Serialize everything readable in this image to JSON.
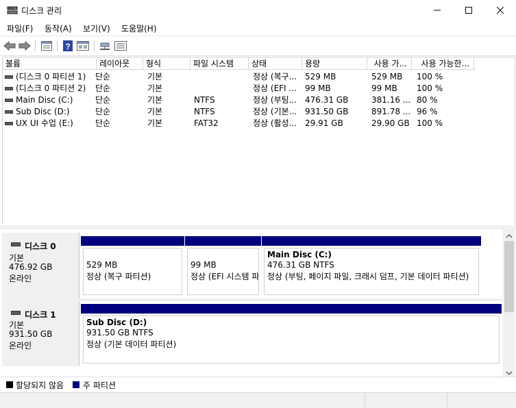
{
  "window": {
    "title": "디스크 관리"
  },
  "menu": [
    "파일(F)",
    "동작(A)",
    "보기(V)",
    "도움말(H)"
  ],
  "toolbar": {
    "buttons": [
      "back-arrow-icon",
      "forward-arrow-icon",
      "properties-icon",
      "help-icon",
      "help-pane-icon",
      "connect-icon",
      "list-icon"
    ]
  },
  "volume_list": {
    "columns": [
      "볼륨",
      "레이아웃",
      "형식",
      "파일 시스템",
      "상태",
      "용량",
      "사용 가...",
      "사용 가능한..."
    ],
    "rows": [
      [
        "(디스크 0 파티션 1)",
        "단순",
        "기본",
        "",
        "정상 (복구...",
        "529 MB",
        "529 MB",
        "100 %"
      ],
      [
        "(디스크 0 파티션 2)",
        "단순",
        "기본",
        "",
        "정상 (EFI ...",
        "99 MB",
        "99 MB",
        "100 %"
      ],
      [
        "Main Disc (C:)",
        "단순",
        "기본",
        "NTFS",
        "정상 (부팅...",
        "476.31 GB",
        "381.16 ...",
        "80 %"
      ],
      [
        "Sub Disc (D:)",
        "단순",
        "기본",
        "NTFS",
        "정상 (기본...",
        "931.50 GB",
        "891.78 ...",
        "96 %"
      ],
      [
        "UX UI 수업 (E:)",
        "단순",
        "기본",
        "FAT32",
        "정상 (활성...",
        "29.91 GB",
        "29.90 GB",
        "100 %"
      ]
    ]
  },
  "disks": [
    {
      "name": "디스크 0",
      "type": "기본",
      "size": "476.92 GB",
      "status": "온라인",
      "partitions": [
        {
          "title": "",
          "size": "529 MB",
          "status": "정상 (복구 파티션)"
        },
        {
          "title": "",
          "size": "99 MB",
          "status": "정상 (EFI 시스템 파"
        },
        {
          "title": "Main Disc  (C:)",
          "size": "476.31 GB NTFS",
          "status": "정상 (부팅, 페이지 파일, 크래시 덤프, 기본 데이터 파티션)"
        }
      ]
    },
    {
      "name": "디스크 1",
      "type": "기본",
      "size": "931.50 GB",
      "status": "온라인",
      "partitions": [
        {
          "title": "Sub Disc  (D:)",
          "size": "931.50 GB NTFS",
          "status": "정상 (기본 데이터 파티션)"
        }
      ]
    }
  ],
  "legend": {
    "items": [
      {
        "label": "할당되지 않음",
        "color": "#000000"
      },
      {
        "label": "주 파티션",
        "color": "#00007f"
      }
    ]
  },
  "colors": {
    "primary_partition": "#00007f",
    "unallocated": "#000000"
  }
}
